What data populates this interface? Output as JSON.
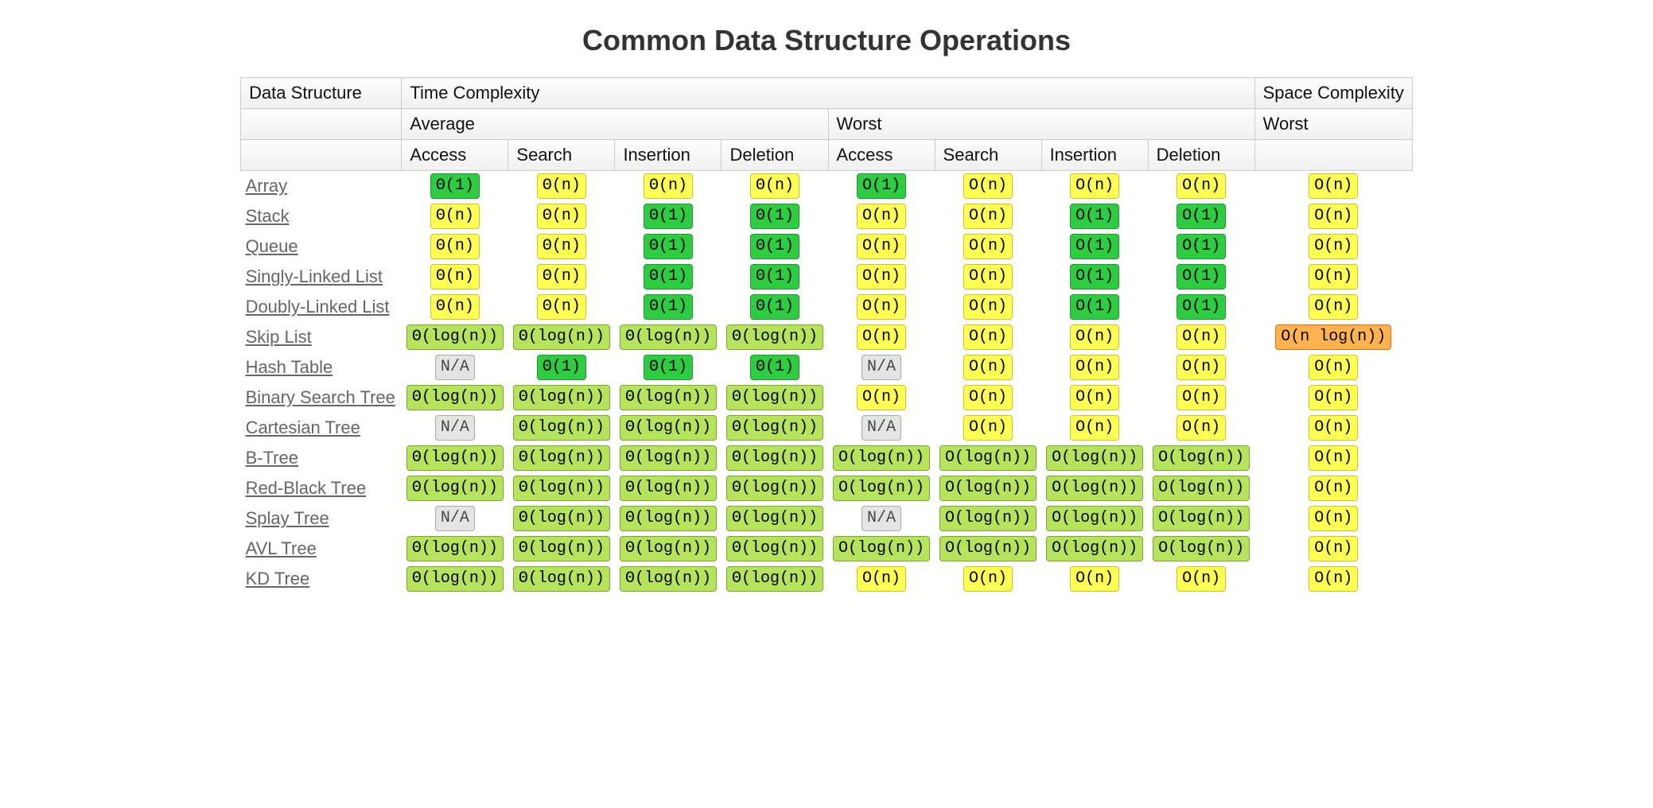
{
  "title": "Common Data Structure Operations",
  "headers": {
    "dataStructure": "Data Structure",
    "timeComplexity": "Time Complexity",
    "spaceComplexity": "Space Complexity",
    "average": "Average",
    "worst": "Worst",
    "ops": [
      "Access",
      "Search",
      "Insertion",
      "Deletion"
    ]
  },
  "colors": {
    "green": "#2ecc40",
    "lime": "#b6e35c",
    "yellow": "#ffff54",
    "orange": "#ffb24d",
    "gray": "#e4e4e4"
  },
  "rows": [
    {
      "name": "Array",
      "avg": [
        {
          "v": "Θ(1)",
          "c": "green"
        },
        {
          "v": "Θ(n)",
          "c": "yellow"
        },
        {
          "v": "Θ(n)",
          "c": "yellow"
        },
        {
          "v": "Θ(n)",
          "c": "yellow"
        }
      ],
      "worst": [
        {
          "v": "O(1)",
          "c": "green"
        },
        {
          "v": "O(n)",
          "c": "yellow"
        },
        {
          "v": "O(n)",
          "c": "yellow"
        },
        {
          "v": "O(n)",
          "c": "yellow"
        }
      ],
      "space": {
        "v": "O(n)",
        "c": "yellow"
      }
    },
    {
      "name": "Stack",
      "avg": [
        {
          "v": "Θ(n)",
          "c": "yellow"
        },
        {
          "v": "Θ(n)",
          "c": "yellow"
        },
        {
          "v": "Θ(1)",
          "c": "green"
        },
        {
          "v": "Θ(1)",
          "c": "green"
        }
      ],
      "worst": [
        {
          "v": "O(n)",
          "c": "yellow"
        },
        {
          "v": "O(n)",
          "c": "yellow"
        },
        {
          "v": "O(1)",
          "c": "green"
        },
        {
          "v": "O(1)",
          "c": "green"
        }
      ],
      "space": {
        "v": "O(n)",
        "c": "yellow"
      }
    },
    {
      "name": "Queue",
      "avg": [
        {
          "v": "Θ(n)",
          "c": "yellow"
        },
        {
          "v": "Θ(n)",
          "c": "yellow"
        },
        {
          "v": "Θ(1)",
          "c": "green"
        },
        {
          "v": "Θ(1)",
          "c": "green"
        }
      ],
      "worst": [
        {
          "v": "O(n)",
          "c": "yellow"
        },
        {
          "v": "O(n)",
          "c": "yellow"
        },
        {
          "v": "O(1)",
          "c": "green"
        },
        {
          "v": "O(1)",
          "c": "green"
        }
      ],
      "space": {
        "v": "O(n)",
        "c": "yellow"
      }
    },
    {
      "name": "Singly-Linked List",
      "avg": [
        {
          "v": "Θ(n)",
          "c": "yellow"
        },
        {
          "v": "Θ(n)",
          "c": "yellow"
        },
        {
          "v": "Θ(1)",
          "c": "green"
        },
        {
          "v": "Θ(1)",
          "c": "green"
        }
      ],
      "worst": [
        {
          "v": "O(n)",
          "c": "yellow"
        },
        {
          "v": "O(n)",
          "c": "yellow"
        },
        {
          "v": "O(1)",
          "c": "green"
        },
        {
          "v": "O(1)",
          "c": "green"
        }
      ],
      "space": {
        "v": "O(n)",
        "c": "yellow"
      }
    },
    {
      "name": "Doubly-Linked List",
      "avg": [
        {
          "v": "Θ(n)",
          "c": "yellow"
        },
        {
          "v": "Θ(n)",
          "c": "yellow"
        },
        {
          "v": "Θ(1)",
          "c": "green"
        },
        {
          "v": "Θ(1)",
          "c": "green"
        }
      ],
      "worst": [
        {
          "v": "O(n)",
          "c": "yellow"
        },
        {
          "v": "O(n)",
          "c": "yellow"
        },
        {
          "v": "O(1)",
          "c": "green"
        },
        {
          "v": "O(1)",
          "c": "green"
        }
      ],
      "space": {
        "v": "O(n)",
        "c": "yellow"
      }
    },
    {
      "name": "Skip List",
      "avg": [
        {
          "v": "Θ(log(n))",
          "c": "lime"
        },
        {
          "v": "Θ(log(n))",
          "c": "lime"
        },
        {
          "v": "Θ(log(n))",
          "c": "lime"
        },
        {
          "v": "Θ(log(n))",
          "c": "lime"
        }
      ],
      "worst": [
        {
          "v": "O(n)",
          "c": "yellow"
        },
        {
          "v": "O(n)",
          "c": "yellow"
        },
        {
          "v": "O(n)",
          "c": "yellow"
        },
        {
          "v": "O(n)",
          "c": "yellow"
        }
      ],
      "space": {
        "v": "O(n log(n))",
        "c": "orange"
      }
    },
    {
      "name": "Hash Table",
      "avg": [
        {
          "v": "N/A",
          "c": "gray"
        },
        {
          "v": "Θ(1)",
          "c": "green"
        },
        {
          "v": "Θ(1)",
          "c": "green"
        },
        {
          "v": "Θ(1)",
          "c": "green"
        }
      ],
      "worst": [
        {
          "v": "N/A",
          "c": "gray"
        },
        {
          "v": "O(n)",
          "c": "yellow"
        },
        {
          "v": "O(n)",
          "c": "yellow"
        },
        {
          "v": "O(n)",
          "c": "yellow"
        }
      ],
      "space": {
        "v": "O(n)",
        "c": "yellow"
      }
    },
    {
      "name": "Binary Search Tree",
      "avg": [
        {
          "v": "Θ(log(n))",
          "c": "lime"
        },
        {
          "v": "Θ(log(n))",
          "c": "lime"
        },
        {
          "v": "Θ(log(n))",
          "c": "lime"
        },
        {
          "v": "Θ(log(n))",
          "c": "lime"
        }
      ],
      "worst": [
        {
          "v": "O(n)",
          "c": "yellow"
        },
        {
          "v": "O(n)",
          "c": "yellow"
        },
        {
          "v": "O(n)",
          "c": "yellow"
        },
        {
          "v": "O(n)",
          "c": "yellow"
        }
      ],
      "space": {
        "v": "O(n)",
        "c": "yellow"
      }
    },
    {
      "name": "Cartesian Tree",
      "avg": [
        {
          "v": "N/A",
          "c": "gray"
        },
        {
          "v": "Θ(log(n))",
          "c": "lime"
        },
        {
          "v": "Θ(log(n))",
          "c": "lime"
        },
        {
          "v": "Θ(log(n))",
          "c": "lime"
        }
      ],
      "worst": [
        {
          "v": "N/A",
          "c": "gray"
        },
        {
          "v": "O(n)",
          "c": "yellow"
        },
        {
          "v": "O(n)",
          "c": "yellow"
        },
        {
          "v": "O(n)",
          "c": "yellow"
        }
      ],
      "space": {
        "v": "O(n)",
        "c": "yellow"
      }
    },
    {
      "name": "B-Tree",
      "avg": [
        {
          "v": "Θ(log(n))",
          "c": "lime"
        },
        {
          "v": "Θ(log(n))",
          "c": "lime"
        },
        {
          "v": "Θ(log(n))",
          "c": "lime"
        },
        {
          "v": "Θ(log(n))",
          "c": "lime"
        }
      ],
      "worst": [
        {
          "v": "O(log(n))",
          "c": "lime"
        },
        {
          "v": "O(log(n))",
          "c": "lime"
        },
        {
          "v": "O(log(n))",
          "c": "lime"
        },
        {
          "v": "O(log(n))",
          "c": "lime"
        }
      ],
      "space": {
        "v": "O(n)",
        "c": "yellow"
      }
    },
    {
      "name": "Red-Black Tree",
      "avg": [
        {
          "v": "Θ(log(n))",
          "c": "lime"
        },
        {
          "v": "Θ(log(n))",
          "c": "lime"
        },
        {
          "v": "Θ(log(n))",
          "c": "lime"
        },
        {
          "v": "Θ(log(n))",
          "c": "lime"
        }
      ],
      "worst": [
        {
          "v": "O(log(n))",
          "c": "lime"
        },
        {
          "v": "O(log(n))",
          "c": "lime"
        },
        {
          "v": "O(log(n))",
          "c": "lime"
        },
        {
          "v": "O(log(n))",
          "c": "lime"
        }
      ],
      "space": {
        "v": "O(n)",
        "c": "yellow"
      }
    },
    {
      "name": "Splay Tree",
      "avg": [
        {
          "v": "N/A",
          "c": "gray"
        },
        {
          "v": "Θ(log(n))",
          "c": "lime"
        },
        {
          "v": "Θ(log(n))",
          "c": "lime"
        },
        {
          "v": "Θ(log(n))",
          "c": "lime"
        }
      ],
      "worst": [
        {
          "v": "N/A",
          "c": "gray"
        },
        {
          "v": "O(log(n))",
          "c": "lime"
        },
        {
          "v": "O(log(n))",
          "c": "lime"
        },
        {
          "v": "O(log(n))",
          "c": "lime"
        }
      ],
      "space": {
        "v": "O(n)",
        "c": "yellow"
      }
    },
    {
      "name": "AVL Tree",
      "avg": [
        {
          "v": "Θ(log(n))",
          "c": "lime"
        },
        {
          "v": "Θ(log(n))",
          "c": "lime"
        },
        {
          "v": "Θ(log(n))",
          "c": "lime"
        },
        {
          "v": "Θ(log(n))",
          "c": "lime"
        }
      ],
      "worst": [
        {
          "v": "O(log(n))",
          "c": "lime"
        },
        {
          "v": "O(log(n))",
          "c": "lime"
        },
        {
          "v": "O(log(n))",
          "c": "lime"
        },
        {
          "v": "O(log(n))",
          "c": "lime"
        }
      ],
      "space": {
        "v": "O(n)",
        "c": "yellow"
      }
    },
    {
      "name": "KD Tree",
      "avg": [
        {
          "v": "Θ(log(n))",
          "c": "lime"
        },
        {
          "v": "Θ(log(n))",
          "c": "lime"
        },
        {
          "v": "Θ(log(n))",
          "c": "lime"
        },
        {
          "v": "Θ(log(n))",
          "c": "lime"
        }
      ],
      "worst": [
        {
          "v": "O(n)",
          "c": "yellow"
        },
        {
          "v": "O(n)",
          "c": "yellow"
        },
        {
          "v": "O(n)",
          "c": "yellow"
        },
        {
          "v": "O(n)",
          "c": "yellow"
        }
      ],
      "space": {
        "v": "O(n)",
        "c": "yellow"
      }
    }
  ]
}
